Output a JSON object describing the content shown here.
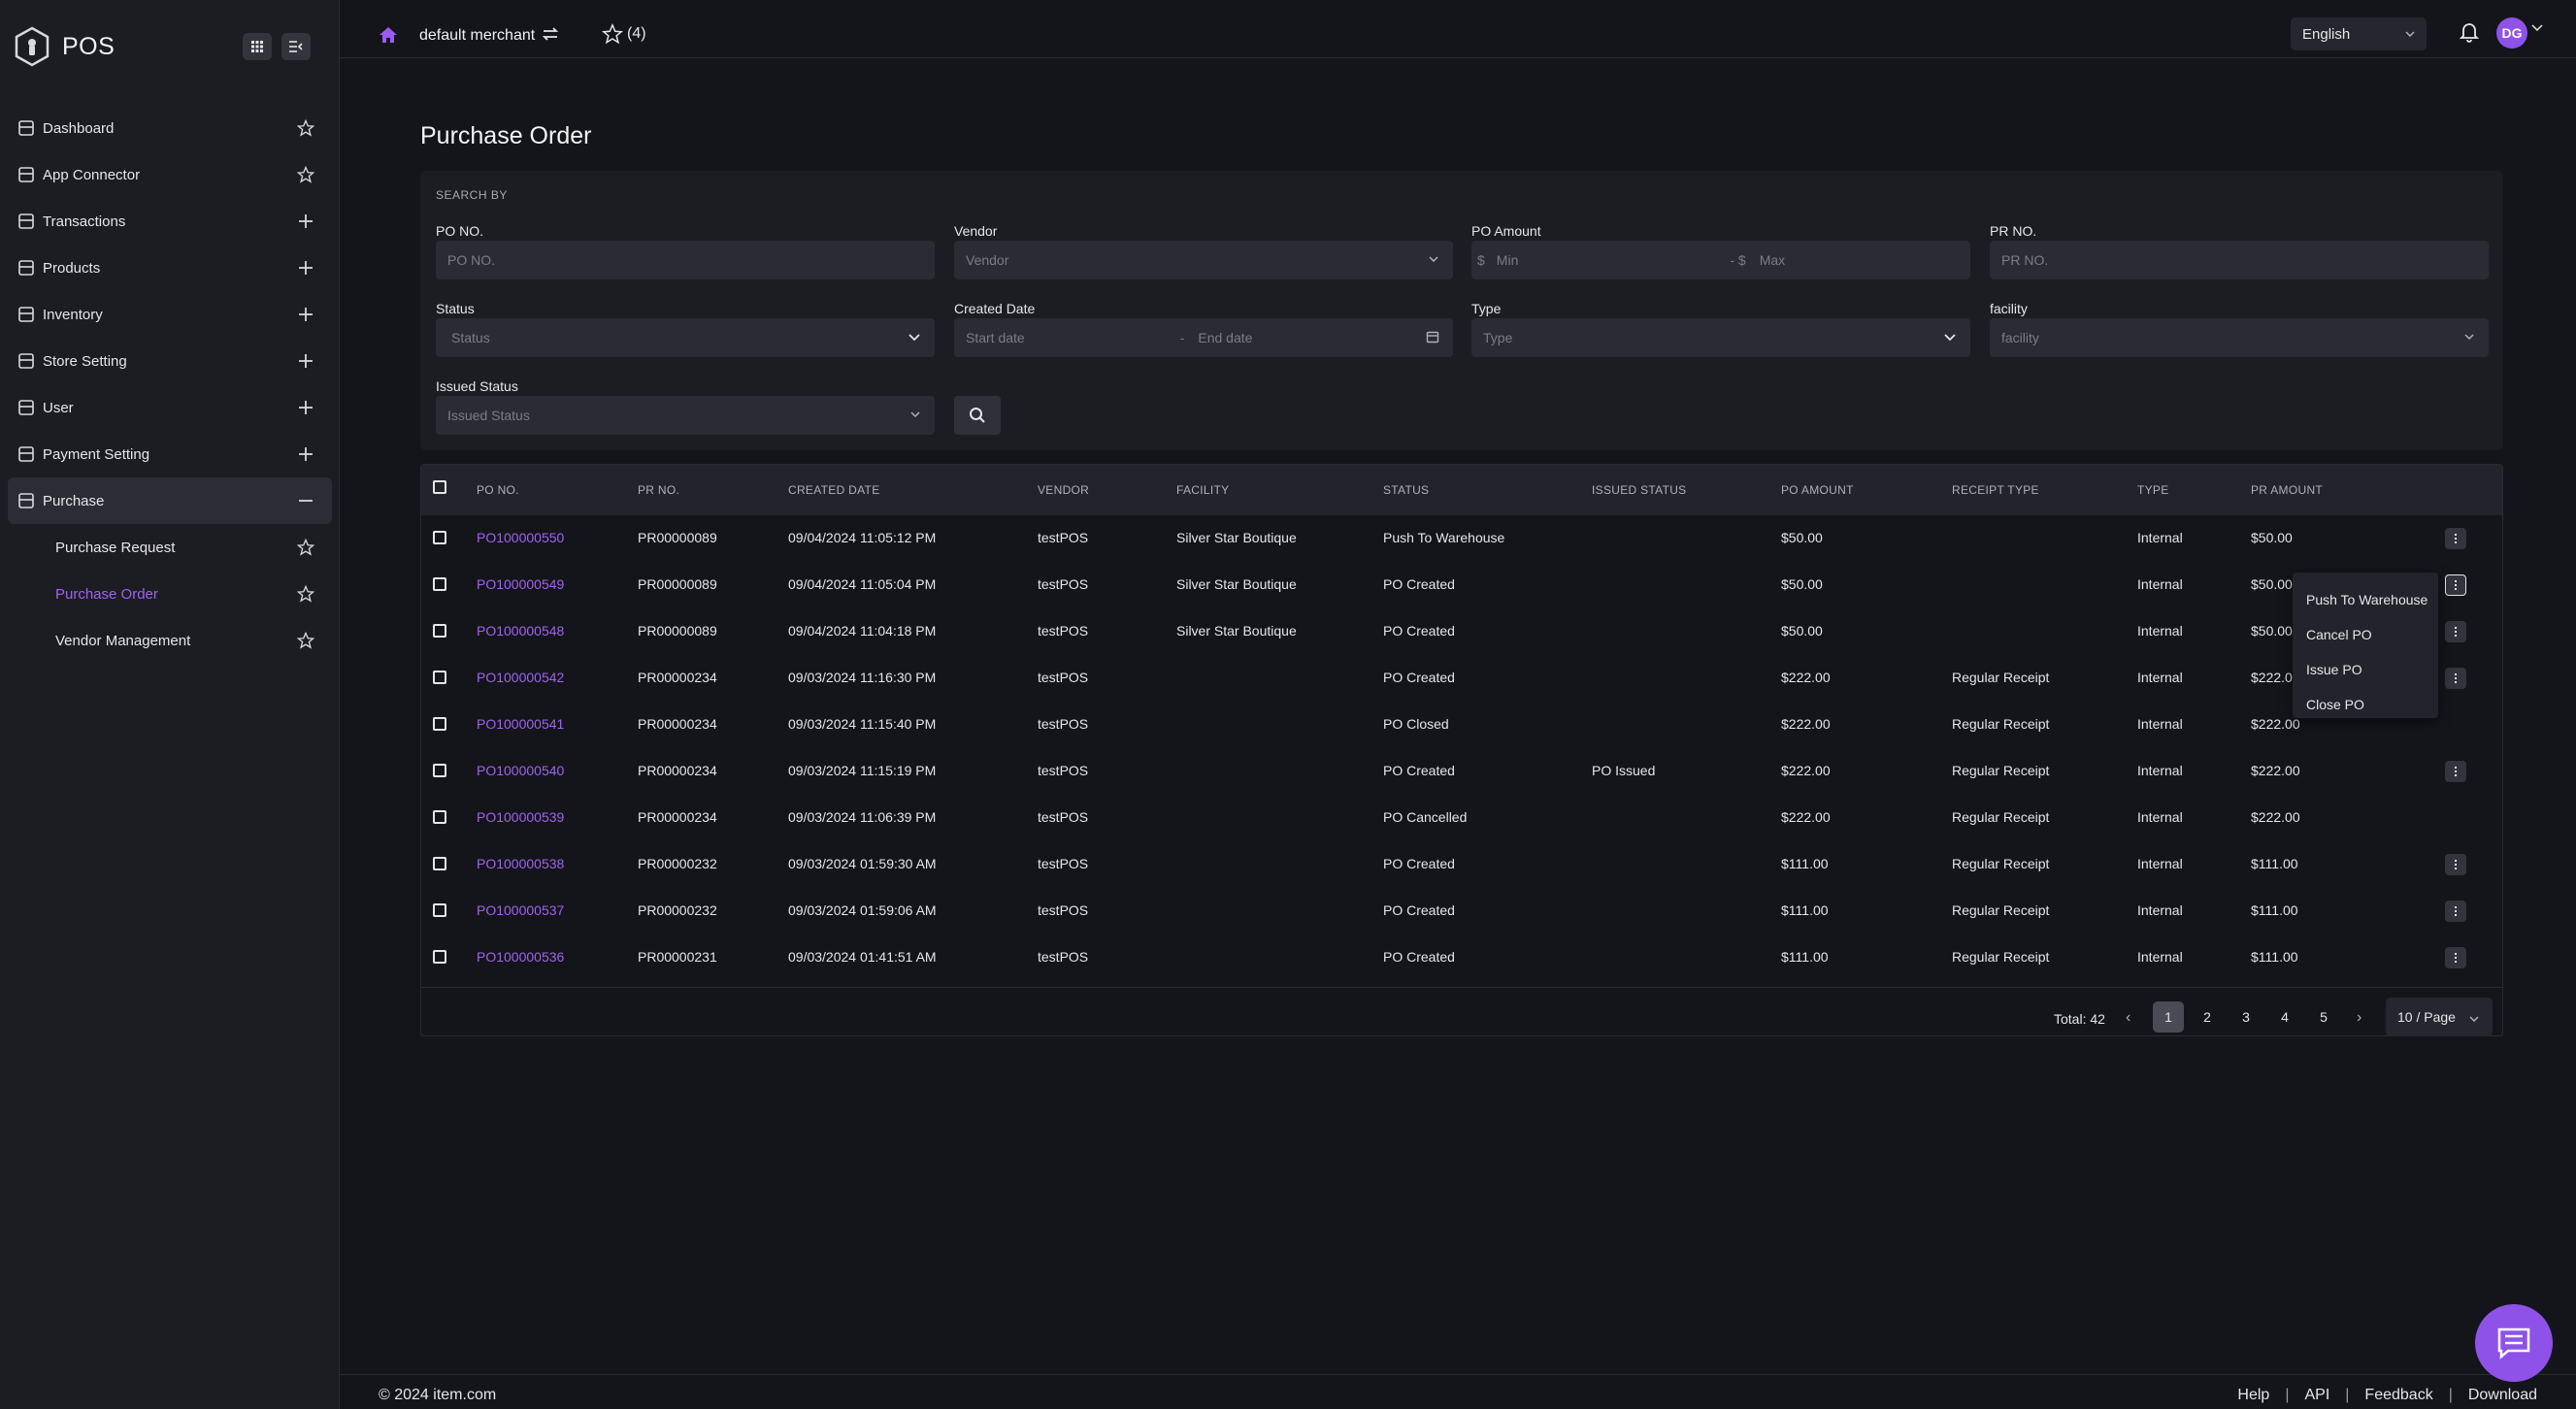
{
  "brand": {
    "name": "POS"
  },
  "topbar": {
    "merchant": "default merchant",
    "favorites_count": "(4)",
    "language": "English",
    "avatar_initials": "DG"
  },
  "sidebar": {
    "items": [
      {
        "label": "Dashboard",
        "icon": "dashboard-icon",
        "action": "star"
      },
      {
        "label": "App Connector",
        "icon": "connector-icon",
        "action": "star"
      },
      {
        "label": "Transactions",
        "icon": "inbox-icon",
        "action": "plus"
      },
      {
        "label": "Products",
        "icon": "tag-icon",
        "action": "plus"
      },
      {
        "label": "Inventory",
        "icon": "box-icon",
        "action": "plus"
      },
      {
        "label": "Store Setting",
        "icon": "store-icon",
        "action": "plus"
      },
      {
        "label": "User",
        "icon": "user-icon",
        "action": "plus"
      },
      {
        "label": "Payment Setting",
        "icon": "payment-icon",
        "action": "plus"
      },
      {
        "label": "Purchase",
        "icon": "purchase-icon",
        "action": "minus"
      }
    ],
    "subitems": [
      {
        "label": "Purchase Request"
      },
      {
        "label": "Purchase Order"
      },
      {
        "label": "Vendor Management"
      }
    ]
  },
  "page": {
    "title": "Purchase Order"
  },
  "search": {
    "heading": "SEARCH BY",
    "po_no": {
      "label": "PO NO.",
      "placeholder": "PO NO."
    },
    "vendor": {
      "label": "Vendor",
      "placeholder": "Vendor"
    },
    "po_amount": {
      "label": "PO Amount",
      "currency": "$",
      "min": "Min",
      "sep": "- $",
      "max": "Max"
    },
    "pr_no": {
      "label": "PR NO.",
      "placeholder": "PR NO."
    },
    "status": {
      "label": "Status",
      "placeholder": "Status"
    },
    "created_date": {
      "label": "Created Date",
      "start": "Start date",
      "sep": "-",
      "end": "End date"
    },
    "type": {
      "label": "Type",
      "placeholder": "Type"
    },
    "facility": {
      "label": "facility",
      "placeholder": "facility"
    },
    "issued_status": {
      "label": "Issued Status",
      "placeholder": "Issued Status"
    }
  },
  "table": {
    "headers": [
      "PO NO.",
      "PR NO.",
      "CREATED DATE",
      "VENDOR",
      "FACILITY",
      "STATUS",
      "ISSUED STATUS",
      "PO AMOUNT",
      "RECEIPT TYPE",
      "TYPE",
      "PR AMOUNT"
    ],
    "rows": [
      {
        "po": "PO100000550",
        "pr": "PR00000089",
        "date": "09/04/2024 11:05:12 PM",
        "vendor": "testPOS",
        "facility": "Silver Star Boutique",
        "status": "Push To Warehouse",
        "issued": "",
        "po_amount": "$50.00",
        "receipt": "",
        "type": "Internal",
        "pr_amount": "$50.00",
        "menu": true
      },
      {
        "po": "PO100000549",
        "pr": "PR00000089",
        "date": "09/04/2024 11:05:04 PM",
        "vendor": "testPOS",
        "facility": "Silver Star Boutique",
        "status": "PO Created",
        "issued": "",
        "po_amount": "$50.00",
        "receipt": "",
        "type": "Internal",
        "pr_amount": "$50.00",
        "menu": true
      },
      {
        "po": "PO100000548",
        "pr": "PR00000089",
        "date": "09/04/2024 11:04:18 PM",
        "vendor": "testPOS",
        "facility": "Silver Star Boutique",
        "status": "PO Created",
        "issued": "",
        "po_amount": "$50.00",
        "receipt": "",
        "type": "Internal",
        "pr_amount": "$50.00",
        "menu": true
      },
      {
        "po": "PO100000542",
        "pr": "PR00000234",
        "date": "09/03/2024 11:16:30 PM",
        "vendor": "testPOS",
        "facility": "",
        "status": "PO Created",
        "issued": "",
        "po_amount": "$222.00",
        "receipt": "Regular Receipt",
        "type": "Internal",
        "pr_amount": "$222.00",
        "menu": true
      },
      {
        "po": "PO100000541",
        "pr": "PR00000234",
        "date": "09/03/2024 11:15:40 PM",
        "vendor": "testPOS",
        "facility": "",
        "status": "PO Closed",
        "issued": "",
        "po_amount": "$222.00",
        "receipt": "Regular Receipt",
        "type": "Internal",
        "pr_amount": "$222.00",
        "menu": false
      },
      {
        "po": "PO100000540",
        "pr": "PR00000234",
        "date": "09/03/2024 11:15:19 PM",
        "vendor": "testPOS",
        "facility": "",
        "status": "PO Created",
        "issued": "PO Issued",
        "po_amount": "$222.00",
        "receipt": "Regular Receipt",
        "type": "Internal",
        "pr_amount": "$222.00",
        "menu": true
      },
      {
        "po": "PO100000539",
        "pr": "PR00000234",
        "date": "09/03/2024 11:06:39 PM",
        "vendor": "testPOS",
        "facility": "",
        "status": "PO Cancelled",
        "issued": "",
        "po_amount": "$222.00",
        "receipt": "Regular Receipt",
        "type": "Internal",
        "pr_amount": "$222.00",
        "menu": false
      },
      {
        "po": "PO100000538",
        "pr": "PR00000232",
        "date": "09/03/2024 01:59:30 AM",
        "vendor": "testPOS",
        "facility": "",
        "status": "PO Created",
        "issued": "",
        "po_amount": "$111.00",
        "receipt": "Regular Receipt",
        "type": "Internal",
        "pr_amount": "$111.00",
        "menu": true
      },
      {
        "po": "PO100000537",
        "pr": "PR00000232",
        "date": "09/03/2024 01:59:06 AM",
        "vendor": "testPOS",
        "facility": "",
        "status": "PO Created",
        "issued": "",
        "po_amount": "$111.00",
        "receipt": "Regular Receipt",
        "type": "Internal",
        "pr_amount": "$111.00",
        "menu": true
      },
      {
        "po": "PO100000536",
        "pr": "PR00000231",
        "date": "09/03/2024 01:41:51 AM",
        "vendor": "testPOS",
        "facility": "",
        "status": "PO Created",
        "issued": "",
        "po_amount": "$111.00",
        "receipt": "Regular Receipt",
        "type": "Internal",
        "pr_amount": "$111.00",
        "menu": true
      }
    ]
  },
  "pagination": {
    "total": "Total: 42",
    "pages": [
      "1",
      "2",
      "3",
      "4",
      "5"
    ],
    "current": "1",
    "page_size": "10 / Page"
  },
  "row_menu": {
    "items": [
      "Push To Warehouse",
      "Cancel PO",
      "Issue PO",
      "Close PO"
    ]
  },
  "footer": {
    "copyright": "© 2024 item.com",
    "links": [
      "Help",
      "API",
      "Feedback",
      "Download"
    ]
  },
  "colors": {
    "accent": "#a062f0",
    "background": "#14151a",
    "sidebar": "#1c1d23"
  }
}
